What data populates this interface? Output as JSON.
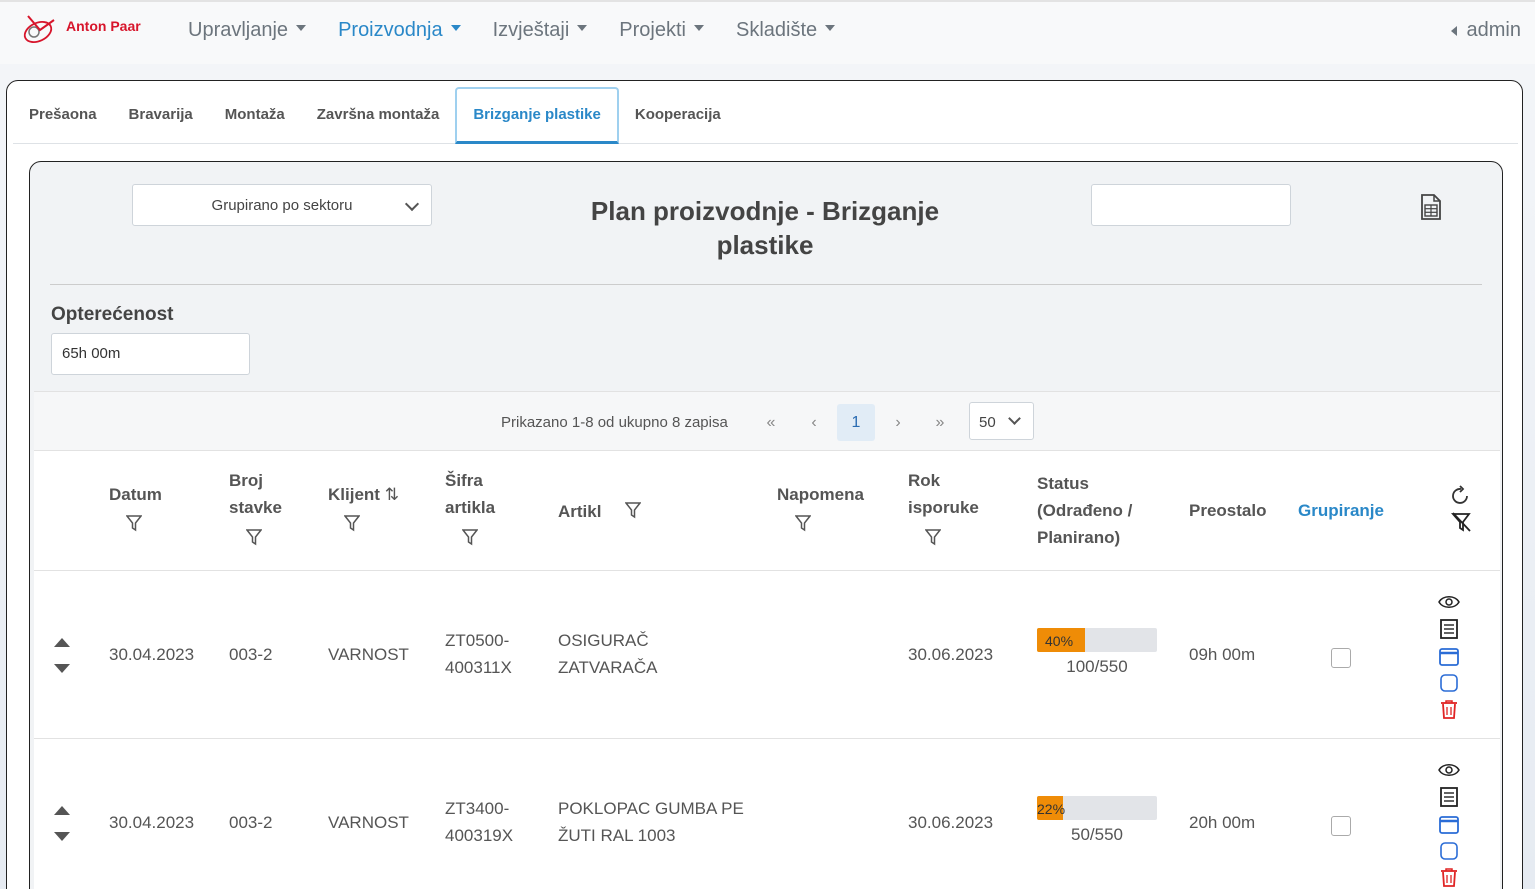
{
  "brand": {
    "name": "Anton Paar",
    "color": "#d7152b"
  },
  "nav": {
    "items": [
      {
        "label": "Upravljanje",
        "active": false
      },
      {
        "label": "Proizvodnja",
        "active": true
      },
      {
        "label": "Izvještaji",
        "active": false
      },
      {
        "label": "Projekti",
        "active": false
      },
      {
        "label": "Skladište",
        "active": false
      }
    ],
    "user": "admin"
  },
  "tabs": [
    {
      "label": "Prešaona",
      "active": false
    },
    {
      "label": "Bravarija",
      "active": false
    },
    {
      "label": "Montaža",
      "active": false
    },
    {
      "label": "Završna montaža",
      "active": false
    },
    {
      "label": "Brizganje plastike",
      "active": true
    },
    {
      "label": "Kooperacija",
      "active": false
    }
  ],
  "toolbar": {
    "grouping_select": "Grupirano po sektoru",
    "title": "Plan proizvodnje - Brizganje plastike",
    "search_value": "",
    "export_icon": "excel-export-icon"
  },
  "load": {
    "label": "Opterećenost",
    "value": "65h 00m"
  },
  "pager": {
    "summary": "Prikazano 1-8 od ukupno 8 zapisa",
    "first": "«",
    "prev": "‹",
    "current": "1",
    "next": "›",
    "last": "»",
    "page_size": "50"
  },
  "table": {
    "headers": {
      "datum": "Datum",
      "broj_stavke": "Broj stavke",
      "klijent": "Klijent",
      "sifra_artikla": "Šifra artikla",
      "artikl": "Artikl",
      "napomena": "Napomena",
      "rok_isporuke": "Rok isporuke",
      "status": "Status (Odrađeno / Planirano)",
      "preostalo": "Preostalo",
      "grupiranje": "Grupiranje"
    },
    "rows": [
      {
        "datum": "30.04.2023",
        "broj_stavke": "003-2",
        "klijent": "VARNOST",
        "sifra_artikla": "ZT0500-400311X",
        "artikl": "OSIGURAČ ZATVARAČA",
        "rok_isporuke": "30.06.2023",
        "progress_percent": 40,
        "progress_label": "40%",
        "status_ratio": "100/550",
        "preostalo": "09h 00m",
        "grupiranje": false
      },
      {
        "datum": "30.04.2023",
        "broj_stavke": "003-2",
        "klijent": "VARNOST",
        "sifra_artikla": "ZT3400-400319X",
        "artikl": "POKLOPAC GUMBA PE ŽUTI RAL 1003",
        "rok_isporuke": "30.06.2023",
        "progress_percent": 22,
        "progress_label": "22%",
        "status_ratio": "50/550",
        "preostalo": "20h 00m",
        "grupiranje": false
      }
    ]
  },
  "colors": {
    "accent": "#2a88c8",
    "progress": "#ef8c07",
    "delete": "#e02424",
    "calendar": "#2a6cd6"
  }
}
